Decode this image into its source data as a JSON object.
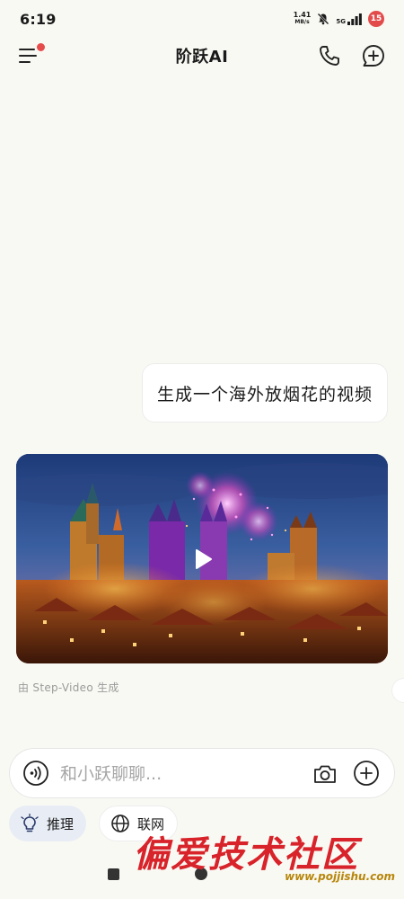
{
  "status_bar": {
    "time": "6:19",
    "net_speed_value": "1.41",
    "net_speed_unit": "MB/s",
    "network_type": "5G",
    "battery": "15"
  },
  "header": {
    "title": "阶跃AI"
  },
  "conversation": {
    "user_message": "生成一个海外放烟花的视频",
    "video_credit": "由 Step-Video 生成"
  },
  "input": {
    "placeholder": "和小跃聊聊..."
  },
  "chips": {
    "reasoning_label": "推理",
    "web_label": "联网"
  },
  "watermark": {
    "text": "偏爱技术社区",
    "url": "www.pojjishu.com"
  },
  "colors": {
    "background": "#f9f9f4",
    "badge_red": "#e34b4b",
    "reason_chip_bg": "#e8edf5",
    "watermark_red": "#d8232a"
  }
}
